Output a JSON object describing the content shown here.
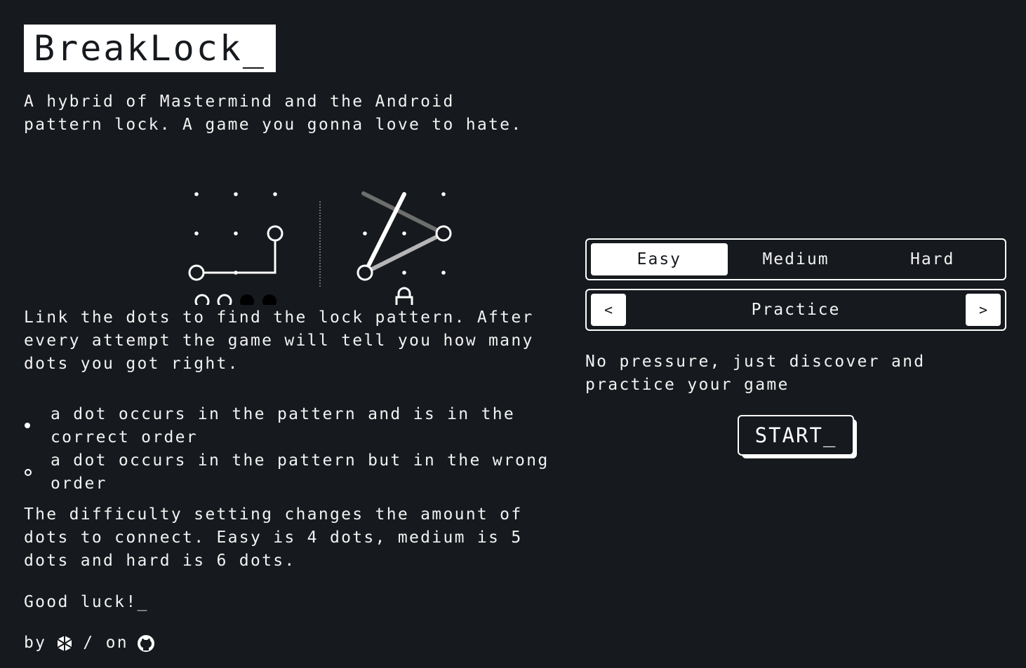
{
  "header": {
    "title": "BreakLock_"
  },
  "intro": "A hybrid of Mastermind and the Android pattern lock. A game you gonna love to hate.",
  "howto": "Link the dots to find the lock pattern. After every attempt the game will tell you how many dots you got right.",
  "legend": [
    {
      "icon": "filled-dot-icon",
      "text": "a dot occurs in the pattern and is in the correct order"
    },
    {
      "icon": "hollow-dot-icon",
      "text": "a dot occurs in the pattern but in the wrong order"
    }
  ],
  "difficulty_text": "The difficulty setting changes the amount of dots to connect. Easy is 4 dots, medium is 5 dots and hard is 6 dots.",
  "good_luck": "Good luck!_",
  "credit": {
    "by": "by",
    "sep": "/ on",
    "author_icon": "author-logo-icon",
    "repo_icon": "github-icon"
  },
  "difficulty": {
    "options": [
      "Easy",
      "Medium",
      "Hard"
    ],
    "selected": "Easy"
  },
  "mode": {
    "prev": "<",
    "label": "Practice",
    "next": ">"
  },
  "mode_description": "No pressure, just discover and practice your game",
  "start_label": "START_",
  "colors": {
    "background": "#16191d",
    "foreground": "#ffffff",
    "dim_line": "#7a7a7a"
  }
}
